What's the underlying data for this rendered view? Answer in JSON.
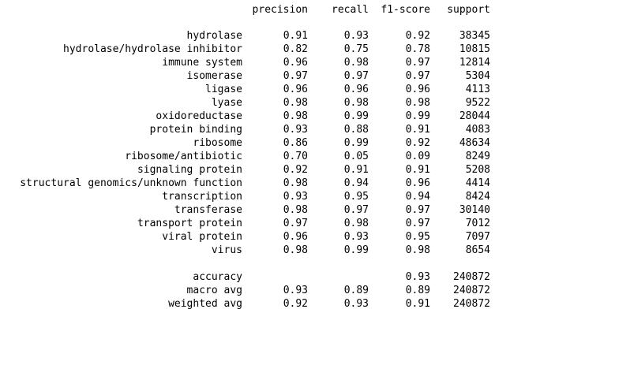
{
  "headers": {
    "precision": "precision",
    "recall": "recall",
    "f1": "f1-score",
    "support": "support"
  },
  "classes": [
    {
      "label": "hydrolase",
      "precision": "0.91",
      "recall": "0.93",
      "f1": "0.92",
      "support": "38345"
    },
    {
      "label": "hydrolase/hydrolase inhibitor",
      "precision": "0.82",
      "recall": "0.75",
      "f1": "0.78",
      "support": "10815"
    },
    {
      "label": "immune system",
      "precision": "0.96",
      "recall": "0.98",
      "f1": "0.97",
      "support": "12814"
    },
    {
      "label": "isomerase",
      "precision": "0.97",
      "recall": "0.97",
      "f1": "0.97",
      "support": "5304"
    },
    {
      "label": "ligase",
      "precision": "0.96",
      "recall": "0.96",
      "f1": "0.96",
      "support": "4113"
    },
    {
      "label": "lyase",
      "precision": "0.98",
      "recall": "0.98",
      "f1": "0.98",
      "support": "9522"
    },
    {
      "label": "oxidoreductase",
      "precision": "0.98",
      "recall": "0.99",
      "f1": "0.99",
      "support": "28044"
    },
    {
      "label": "protein binding",
      "precision": "0.93",
      "recall": "0.88",
      "f1": "0.91",
      "support": "4083"
    },
    {
      "label": "ribosome",
      "precision": "0.86",
      "recall": "0.99",
      "f1": "0.92",
      "support": "48634"
    },
    {
      "label": "ribosome/antibiotic",
      "precision": "0.70",
      "recall": "0.05",
      "f1": "0.09",
      "support": "8249"
    },
    {
      "label": "signaling protein",
      "precision": "0.92",
      "recall": "0.91",
      "f1": "0.91",
      "support": "5208"
    },
    {
      "label": "structural genomics/unknown function",
      "precision": "0.98",
      "recall": "0.94",
      "f1": "0.96",
      "support": "4414"
    },
    {
      "label": "transcription",
      "precision": "0.93",
      "recall": "0.95",
      "f1": "0.94",
      "support": "8424"
    },
    {
      "label": "transferase",
      "precision": "0.98",
      "recall": "0.97",
      "f1": "0.97",
      "support": "30140"
    },
    {
      "label": "transport protein",
      "precision": "0.97",
      "recall": "0.98",
      "f1": "0.97",
      "support": "7012"
    },
    {
      "label": "viral protein",
      "precision": "0.96",
      "recall": "0.93",
      "f1": "0.95",
      "support": "7097"
    },
    {
      "label": "virus",
      "precision": "0.98",
      "recall": "0.99",
      "f1": "0.98",
      "support": "8654"
    }
  ],
  "summary": {
    "accuracy": {
      "label": "accuracy",
      "f1": "0.93",
      "support": "240872"
    },
    "macro": {
      "label": "macro avg",
      "precision": "0.93",
      "recall": "0.89",
      "f1": "0.89",
      "support": "240872"
    },
    "weighted": {
      "label": "weighted avg",
      "precision": "0.92",
      "recall": "0.93",
      "f1": "0.91",
      "support": "240872"
    }
  }
}
